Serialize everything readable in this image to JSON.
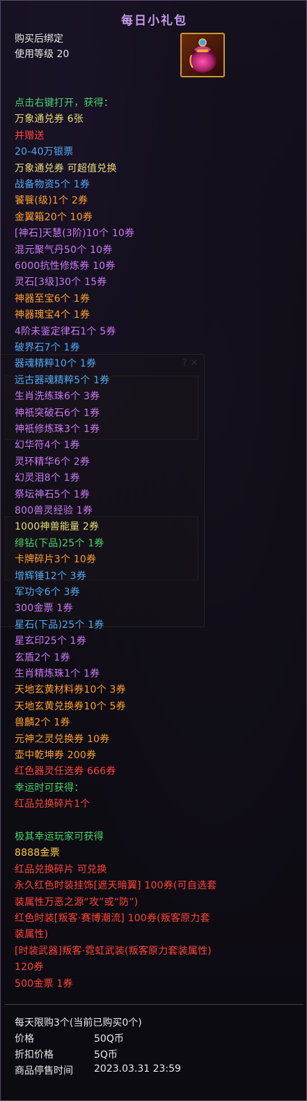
{
  "tooltip": {
    "title": "每日小礼包",
    "bind_text": "购买后绑定",
    "level_text": "使用等级 20",
    "icon": "gift-bag-icon",
    "lines": [
      {
        "text": "点击右键打开，获得：",
        "color": "green"
      },
      {
        "text": "万象通兑券 6张",
        "color": "yellow"
      },
      {
        "text": "并赠送",
        "color": "red"
      },
      {
        "text": "20-40万银票",
        "color": "blue"
      },
      {
        "text": "万象通兑券 可超值兑换",
        "color": "yellow"
      },
      {
        "text": "战备物资5个 1券",
        "color": "blue"
      },
      {
        "text": "饕餮(级)1个 2券",
        "color": "orange"
      },
      {
        "text": "金翼箱20个 10券",
        "color": "orange"
      },
      {
        "text": "[神石]天慧(3阶)10个 10券",
        "color": "purple"
      },
      {
        "text": "混元聚气丹50个 10券",
        "color": "purple"
      },
      {
        "text": "6000抗性修炼券 10券",
        "color": "purple"
      },
      {
        "text": "灵石[3级]30个 15券",
        "color": "purple"
      },
      {
        "text": "神器至宝6个 1券",
        "color": "orange"
      },
      {
        "text": "神器瑰宝4个 1券",
        "color": "orange"
      },
      {
        "text": "4阶未鉴定律石1个 5券",
        "color": "purple"
      },
      {
        "text": "破界石7个 1券",
        "color": "blue"
      },
      {
        "text": "器魂精粹10个 1券",
        "color": "blue"
      },
      {
        "text": "远古器魂精粹5个 1券",
        "color": "blue"
      },
      {
        "text": "生肖洗练珠6个 3券",
        "color": "purple"
      },
      {
        "text": "神祇突破石6个 1券",
        "color": "purple"
      },
      {
        "text": "神祇修炼珠3个 1券",
        "color": "purple"
      },
      {
        "text": "幻华符4个 1券",
        "color": "purple"
      },
      {
        "text": "灵环精华6个 2券",
        "color": "purple"
      },
      {
        "text": "幻灵泪8个 1券",
        "color": "purple"
      },
      {
        "text": "祭坛神石5个 1券",
        "color": "purple"
      },
      {
        "text": "800兽灵经验 1券",
        "color": "purple"
      },
      {
        "text": "1000神兽能量 2券",
        "color": "yellow"
      },
      {
        "text": "绯钻(下品)25个 1券",
        "color": "green"
      },
      {
        "text": "卡牌碎片3个 10券",
        "color": "orange"
      },
      {
        "text": "增辉锤12个 3券",
        "color": "blue"
      },
      {
        "text": "军功令6个 3券",
        "color": "blue"
      },
      {
        "text": "300金票 1券",
        "color": "purple"
      },
      {
        "text": "星石(下品)25个 1券",
        "color": "blue"
      },
      {
        "text": "星玄印25个 1券",
        "color": "purple"
      },
      {
        "text": "玄盾2个 1券",
        "color": "purple"
      },
      {
        "text": "生肖精炼珠1个 1券",
        "color": "purple"
      },
      {
        "text": "天地玄黄材料券10个 3券",
        "color": "orange"
      },
      {
        "text": "天地玄黄兑换券10个 5券",
        "color": "orange"
      },
      {
        "text": "兽麟2个 1券",
        "color": "orange"
      },
      {
        "text": "元神之灵兑换券 10券",
        "color": "orange"
      },
      {
        "text": "壶中乾坤券 200券",
        "color": "orange"
      },
      {
        "text": "红色器灵任选券 666券",
        "color": "red"
      },
      {
        "text": "幸运时可获得：",
        "color": "green"
      },
      {
        "text": "红品兑换碎片1个",
        "color": "red"
      },
      {
        "text": "",
        "color": "white"
      },
      {
        "text": "极其幸运玩家可获得",
        "color": "green"
      },
      {
        "text": "8888金票",
        "color": "gold"
      },
      {
        "text": "红品兑换碎片 可兑换",
        "color": "red"
      },
      {
        "text": "永久红色时装挂饰[遮天暗翼] 100券(可自选套",
        "color": "red"
      },
      {
        "text": "装属性万恶之源“攻”或“防”)",
        "color": "red"
      },
      {
        "text": "红色时装[叛客·赛博潮流] 100券(叛客原力套",
        "color": "red"
      },
      {
        "text": "装属性)",
        "color": "red"
      },
      {
        "text": "[时装武器]叛客·霓虹武装(叛客原力套装属性)",
        "color": "red"
      },
      {
        "text": " 120券",
        "color": "red"
      },
      {
        "text": "500金票 1券",
        "color": "red"
      }
    ],
    "purchase_limit": "每天限购3个(当前已购买0个)",
    "price_label": "价格",
    "price_value": "50Q币",
    "discount_label": "折扣价格",
    "discount_value": "5Q币",
    "stop_label": "商品停售时间",
    "stop_value": "2023.03.31 23:59"
  },
  "colors": {
    "green": "#49d46c",
    "yellow": "#e8de7a",
    "red": "#ff4438",
    "blue": "#52a8f0",
    "orange": "#ffa030",
    "purple": "#c779f0",
    "gold": "#ffcc44",
    "white": "#e8e8e8"
  }
}
